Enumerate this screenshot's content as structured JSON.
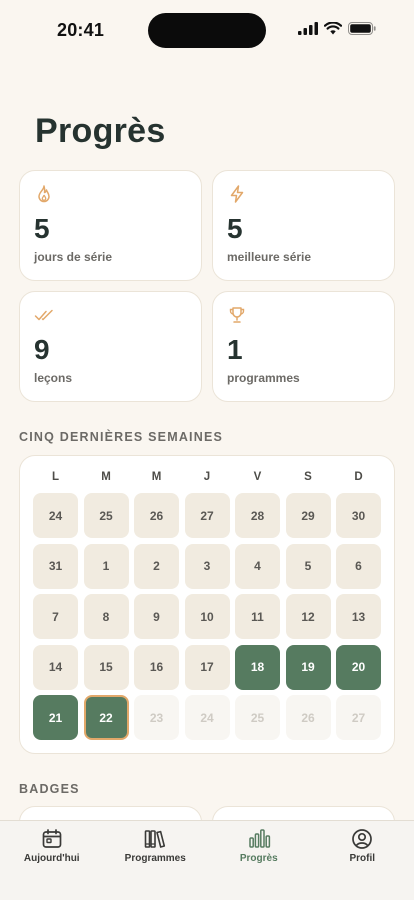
{
  "status": {
    "time": "20:41"
  },
  "page": {
    "title": "Progrès"
  },
  "stats": [
    {
      "icon": "flame-icon",
      "value": "5",
      "label": "jours de série"
    },
    {
      "icon": "lightning-icon",
      "value": "5",
      "label": "meilleure série"
    },
    {
      "icon": "double-check-icon",
      "value": "9",
      "label": "leçons"
    },
    {
      "icon": "trophy-icon",
      "value": "1",
      "label": "programmes"
    }
  ],
  "calendar": {
    "title": "CINQ DERNIÈRES SEMAINES",
    "weekdays": [
      "L",
      "M",
      "M",
      "J",
      "V",
      "S",
      "D"
    ],
    "days": [
      {
        "n": "24",
        "s": "past"
      },
      {
        "n": "25",
        "s": "past"
      },
      {
        "n": "26",
        "s": "past"
      },
      {
        "n": "27",
        "s": "past"
      },
      {
        "n": "28",
        "s": "past"
      },
      {
        "n": "29",
        "s": "past"
      },
      {
        "n": "30",
        "s": "past"
      },
      {
        "n": "31",
        "s": "past"
      },
      {
        "n": "1",
        "s": "past"
      },
      {
        "n": "2",
        "s": "past"
      },
      {
        "n": "3",
        "s": "past"
      },
      {
        "n": "4",
        "s": "past"
      },
      {
        "n": "5",
        "s": "past"
      },
      {
        "n": "6",
        "s": "past"
      },
      {
        "n": "7",
        "s": "past"
      },
      {
        "n": "8",
        "s": "past"
      },
      {
        "n": "9",
        "s": "past"
      },
      {
        "n": "10",
        "s": "past"
      },
      {
        "n": "11",
        "s": "past"
      },
      {
        "n": "12",
        "s": "past"
      },
      {
        "n": "13",
        "s": "past"
      },
      {
        "n": "14",
        "s": "past"
      },
      {
        "n": "15",
        "s": "past"
      },
      {
        "n": "16",
        "s": "past"
      },
      {
        "n": "17",
        "s": "past"
      },
      {
        "n": "18",
        "s": "done"
      },
      {
        "n": "19",
        "s": "done"
      },
      {
        "n": "20",
        "s": "done"
      },
      {
        "n": "21",
        "s": "done"
      },
      {
        "n": "22",
        "s": "today"
      },
      {
        "n": "23",
        "s": "future"
      },
      {
        "n": "24",
        "s": "future"
      },
      {
        "n": "25",
        "s": "future"
      },
      {
        "n": "26",
        "s": "future"
      },
      {
        "n": "27",
        "s": "future"
      }
    ]
  },
  "badges": {
    "title": "BADGES"
  },
  "tabs": [
    {
      "label": "Aujourd'hui",
      "icon": "calendar-icon",
      "active": false
    },
    {
      "label": "Programmes",
      "icon": "books-icon",
      "active": false
    },
    {
      "label": "Progrès",
      "icon": "bar-chart-icon",
      "active": true
    },
    {
      "label": "Profil",
      "icon": "user-circle-icon",
      "active": false
    }
  ],
  "colors": {
    "accent": "#567b60",
    "icon_orange": "#e2a86a",
    "background": "#faf6f0"
  }
}
